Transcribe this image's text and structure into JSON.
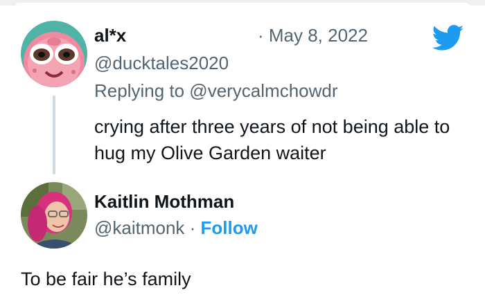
{
  "tweet": {
    "author_name": "al*x",
    "date_text": "· May 8, 2022",
    "handle": "@ducktales2020",
    "replying_to": "Replying to @verycalmchowdr",
    "text": "crying after three years of not being able to hug my Olive Garden waiter"
  },
  "reply": {
    "author_name": "Kaitlin Mothman",
    "handle": "@kaitmonk",
    "separator": " · ",
    "follow_label": "Follow",
    "text": "To be fair he’s family"
  },
  "icons": {
    "brand": "twitter-bird-icon"
  },
  "colors": {
    "brand_blue": "#1d9bf0",
    "text_primary": "#0f1419",
    "text_secondary": "#536471",
    "thread_line": "#cfd9de"
  }
}
